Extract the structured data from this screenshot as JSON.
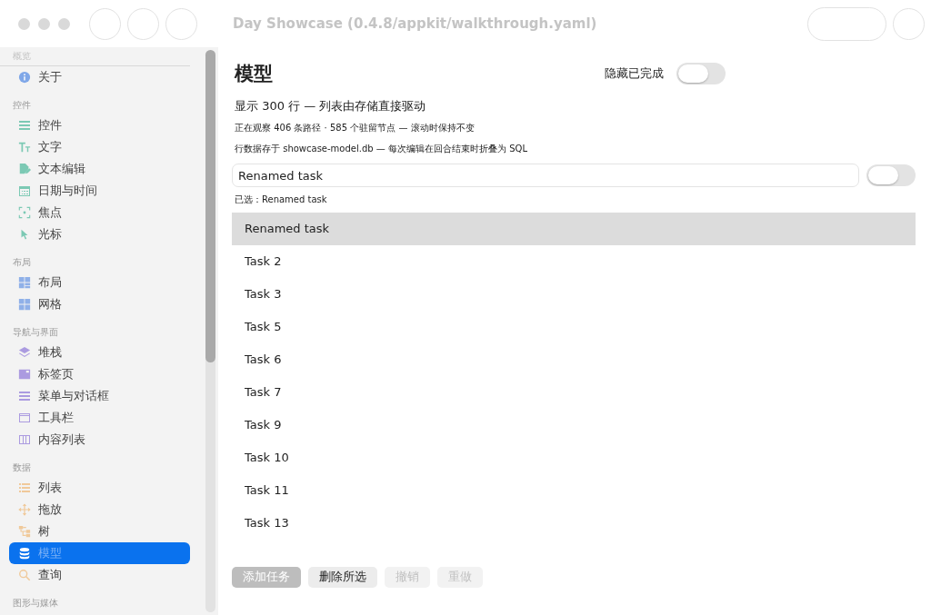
{
  "window": {
    "title": "Day Showcase (0.4.8/appkit/walkthrough.yaml)"
  },
  "sidebar": {
    "sections": [
      {
        "header": "概览",
        "items": [
          {
            "label": "关于",
            "kind": "info",
            "color": "#7fa7e8",
            "selected": false
          }
        ]
      },
      {
        "header": "控件",
        "items": [
          {
            "label": "控件",
            "kind": "sliders",
            "color": "#7cc9b4",
            "selected": false
          },
          {
            "label": "文字",
            "kind": "text",
            "color": "#7cc9b4",
            "selected": false
          },
          {
            "label": "文本编辑",
            "kind": "doc",
            "color": "#7cc9b4",
            "selected": false
          },
          {
            "label": "日期与时间",
            "kind": "calendar",
            "color": "#7cc9b4",
            "selected": false
          },
          {
            "label": "焦点",
            "kind": "focus",
            "color": "#7cc9b4",
            "selected": false
          },
          {
            "label": "光标",
            "kind": "pointer",
            "color": "#7cc9b4",
            "selected": false
          }
        ]
      },
      {
        "header": "布局",
        "items": [
          {
            "label": "布局",
            "kind": "layout",
            "color": "#8fb0e8",
            "selected": false
          },
          {
            "label": "网格",
            "kind": "grid",
            "color": "#8fb0e8",
            "selected": false
          }
        ]
      },
      {
        "header": "导航与界面",
        "items": [
          {
            "label": "堆栈",
            "kind": "stack",
            "color": "#ab9be0",
            "selected": false
          },
          {
            "label": "标签页",
            "kind": "tab",
            "color": "#ab9be0",
            "selected": false
          },
          {
            "label": "菜单与对话框",
            "kind": "menu",
            "color": "#ab9be0",
            "selected": false
          },
          {
            "label": "工具栏",
            "kind": "window",
            "color": "#ab9be0",
            "selected": false
          },
          {
            "label": "内容列表",
            "kind": "columns",
            "color": "#ab9be0",
            "selected": false
          }
        ]
      },
      {
        "header": "数据",
        "items": [
          {
            "label": "列表",
            "kind": "list",
            "color": "#f0c99a",
            "selected": false
          },
          {
            "label": "拖放",
            "kind": "move",
            "color": "#f0c99a",
            "selected": false
          },
          {
            "label": "树",
            "kind": "tree",
            "color": "#f0c99a",
            "selected": false
          },
          {
            "label": "模型",
            "kind": "database",
            "selected": true
          },
          {
            "label": "查询",
            "kind": "search",
            "color": "#f0c99a",
            "selected": false
          }
        ]
      },
      {
        "header": "图形与媒体"
      }
    ]
  },
  "content": {
    "title": "模型",
    "hide_completed": {
      "label": "隐藏已完成",
      "on": false
    },
    "summary": "显示 300 行 — 列表由存储直接驱动",
    "stats": "正在观察 406 条路径 · 585 个驻留节点 — 滚动时保持不变",
    "storage": "行数据存于 showcase-model.db — 每次编辑在回合结束时折叠为 SQL",
    "edit_field": {
      "value": "Renamed task"
    },
    "edit_toggle": {
      "on": false
    },
    "selection": "已选：Renamed task",
    "rows": [
      {
        "label": "Renamed task",
        "selected": true
      },
      {
        "label": "Task 2",
        "selected": false
      },
      {
        "label": "Task 3",
        "selected": false
      },
      {
        "label": "Task 5",
        "selected": false
      },
      {
        "label": "Task 6",
        "selected": false
      },
      {
        "label": "Task 7",
        "selected": false
      },
      {
        "label": "Task 9",
        "selected": false
      },
      {
        "label": "Task 10",
        "selected": false
      },
      {
        "label": "Task 11",
        "selected": false
      },
      {
        "label": "Task 13",
        "selected": false
      }
    ],
    "buttons": [
      {
        "label": "添加任务",
        "kind": "primary",
        "disabled": true
      },
      {
        "label": "删除所选",
        "kind": "plain",
        "disabled": false
      },
      {
        "label": "撤销",
        "kind": "plain",
        "disabled": true
      },
      {
        "label": "重做",
        "kind": "plain",
        "disabled": true
      }
    ]
  }
}
